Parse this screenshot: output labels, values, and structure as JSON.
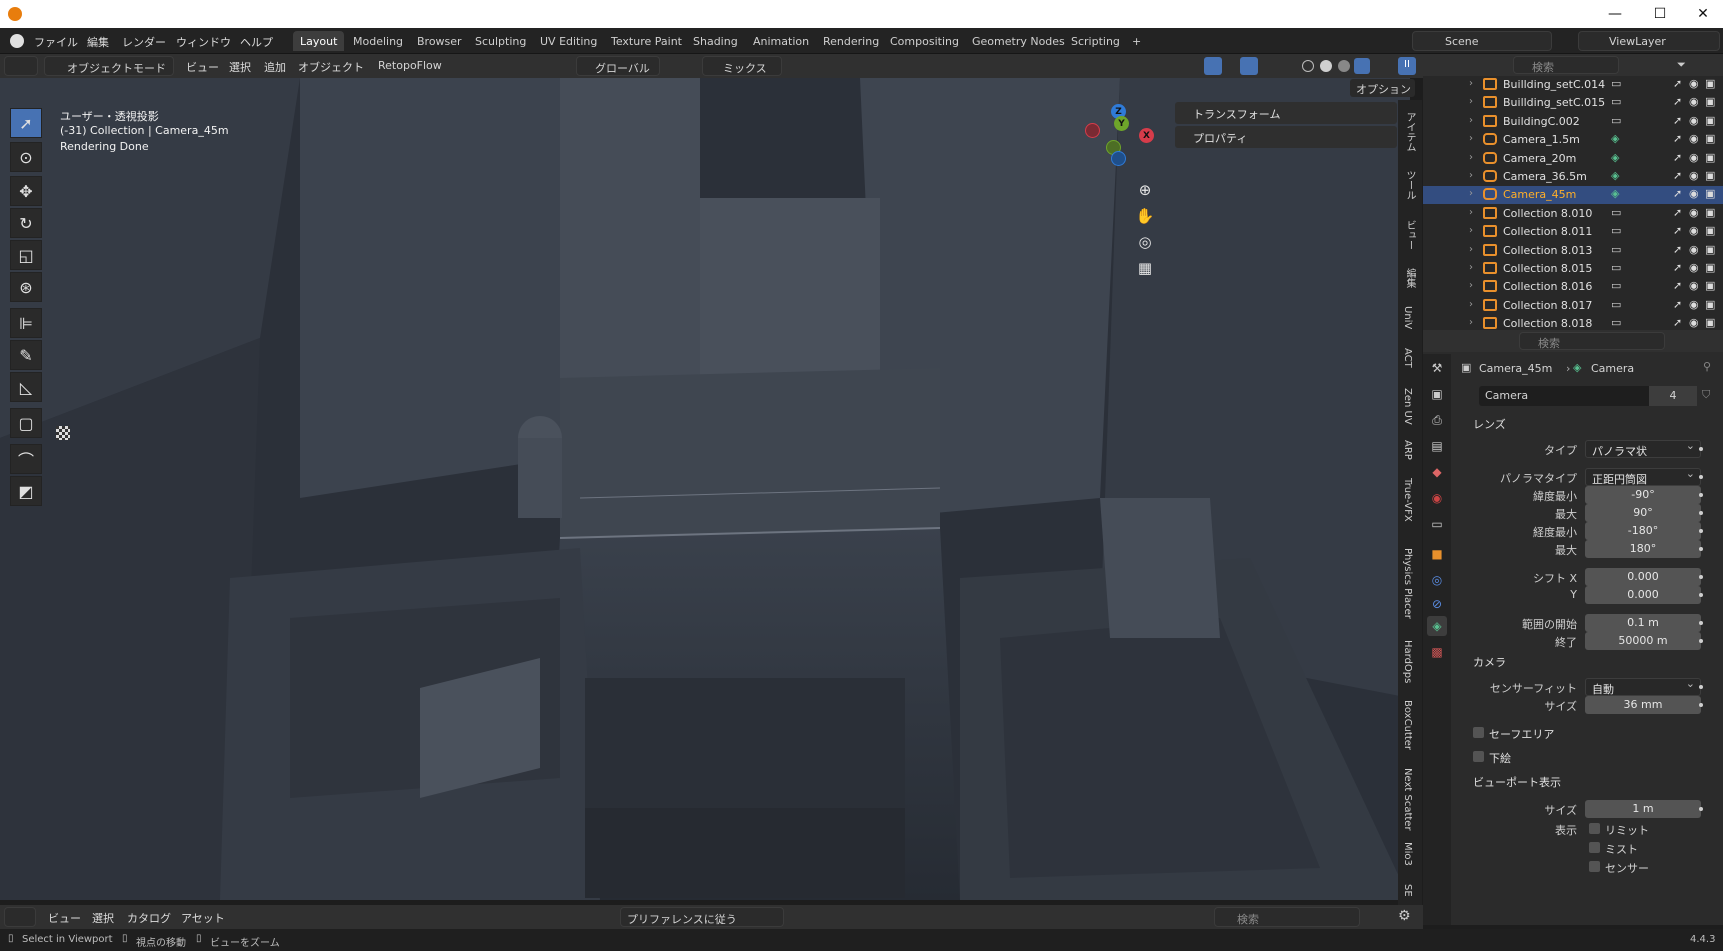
{
  "titlebar": {
    "minimize": "—",
    "maximize": "☐",
    "close": "✕"
  },
  "menu": {
    "file": "ファイル",
    "edit": "編集",
    "render": "レンダー",
    "window": "ウィンドウ",
    "help": "ヘルプ"
  },
  "workspaces": [
    "Layout",
    "Modeling",
    "Browser",
    "Sculpting",
    "UV Editing",
    "Texture Paint",
    "Shading",
    "Animation",
    "Rendering",
    "Compositing",
    "Geometry Nodes",
    "Scripting"
  ],
  "workspace_add": "+",
  "scene": {
    "name": "Scene",
    "view_layer": "ViewLayer"
  },
  "viewport_header": {
    "mode": "オブジェクトモード",
    "view": "ビュー",
    "select": "選択",
    "add": "追加",
    "object": "オブジェクト",
    "addon": "RetopoFlow",
    "transform_orientation": "グローバル",
    "snap": "ミックス",
    "options": "オプション"
  },
  "viewport": {
    "projection": "ユーザー・透視投影",
    "collection_info": "(-31) Collection | Camera_45m",
    "status": "Rendering Done"
  },
  "gizmo": {
    "z": "Z",
    "y": "Y",
    "x": "X"
  },
  "npanel": {
    "transform": "トランスフォーム",
    "properties": "プロパティ"
  },
  "vertical_tabs": [
    "アイテム",
    "ツール",
    "ビュー",
    "編集",
    "UniV",
    "ACT",
    "Zen UV",
    "ARP",
    "True-VFX",
    "Physics Placer",
    "HardOps",
    "BoxCutter",
    "Next Scatter",
    "Mio3",
    "SE"
  ],
  "outliner": {
    "search_placeholder": "検索",
    "items": [
      {
        "name": "Buillding_setC.014",
        "type": "collection"
      },
      {
        "name": "Buillding_setC.015",
        "type": "collection"
      },
      {
        "name": "BuildingC.002",
        "type": "collection"
      },
      {
        "name": "Camera_1.5m",
        "type": "camera"
      },
      {
        "name": "Camera_20m",
        "type": "camera"
      },
      {
        "name": "Camera_36.5m",
        "type": "camera"
      },
      {
        "name": "Camera_45m",
        "type": "camera",
        "selected": true
      },
      {
        "name": "Collection 8.010",
        "type": "collection"
      },
      {
        "name": "Collection 8.011",
        "type": "collection"
      },
      {
        "name": "Collection 8.013",
        "type": "collection"
      },
      {
        "name": "Collection 8.015",
        "type": "collection"
      },
      {
        "name": "Collection 8.016",
        "type": "collection"
      },
      {
        "name": "Collection 8.017",
        "type": "collection"
      },
      {
        "name": "Collection 8.018",
        "type": "collection"
      }
    ]
  },
  "properties": {
    "search_placeholder": "検索",
    "breadcrumb_object": "Camera_45m",
    "breadcrumb_data": "Camera",
    "data_name": "Camera",
    "users": "4",
    "lens_section": "レンズ",
    "type_label": "タイプ",
    "type_value": "パノラマ状",
    "pano_type_label": "パノラマタイプ",
    "pano_type_value": "正距円筒図",
    "lat_min_label": "緯度最小",
    "lat_min": "-90°",
    "lat_max_label": "最大",
    "lat_max": "90°",
    "lon_min_label": "経度最小",
    "lon_min": "-180°",
    "lon_max_label": "最大",
    "lon_max": "180°",
    "shift_x_label": "シフト X",
    "shift_x": "0.000",
    "shift_y_label": "Y",
    "shift_y": "0.000",
    "clip_start_label": "範囲の開始",
    "clip_start": "0.1 m",
    "clip_end_label": "終了",
    "clip_end": "50000 m",
    "camera_section": "カメラ",
    "sensor_fit_label": "センサーフィット",
    "sensor_fit": "自動",
    "size_label": "サイズ",
    "size": "36 mm",
    "safe_areas": "セーフエリア",
    "background": "下絵",
    "viewport_display": "ビューポート表示",
    "vp_size_label": "サイズ",
    "vp_size": "1 m",
    "show_label": "表示",
    "limits": "リミット",
    "mist": "ミスト",
    "sensor": "センサー"
  },
  "asset_bar": {
    "view": "ビュー",
    "select": "選択",
    "catalog": "カタログ",
    "asset": "アセット",
    "import_method": "プリファレンスに従う",
    "search_placeholder": "検索"
  },
  "statusbar": {
    "select": "Select in Viewport",
    "move": "視点の移動",
    "zoom": "ビューをズーム",
    "version": "4.4.3"
  }
}
